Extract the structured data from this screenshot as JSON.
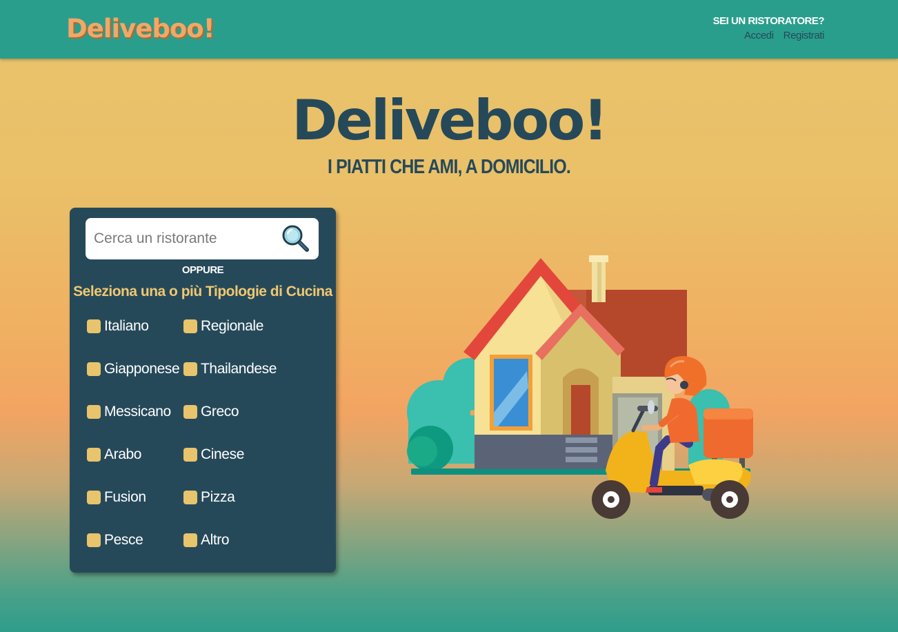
{
  "navbar": {
    "logo": "Deliveboo!",
    "restaurateur_question": "SEI UN RISTORATORE?",
    "login_label": "Accedi",
    "register_label": "Registrati"
  },
  "hero": {
    "title": "Deliveboo!",
    "subtitle": "I PIATTI CHE AMI, A DOMICILIO."
  },
  "search": {
    "placeholder": "Cerca un ristorante",
    "value": ""
  },
  "filters": {
    "separator": "OPPURE",
    "title": "Seleziona una o più Tipologie di Cucina",
    "cuisines": [
      {
        "label": "Italiano",
        "checked": false
      },
      {
        "label": "Regionale",
        "checked": false
      },
      {
        "label": "Giapponese",
        "checked": false
      },
      {
        "label": "Thailandese",
        "checked": false
      },
      {
        "label": "Messicano",
        "checked": false
      },
      {
        "label": "Greco",
        "checked": false
      },
      {
        "label": "Arabo",
        "checked": false
      },
      {
        "label": "Cinese",
        "checked": false
      },
      {
        "label": "Fusion",
        "checked": false
      },
      {
        "label": "Pizza",
        "checked": false
      },
      {
        "label": "Pesce",
        "checked": false
      },
      {
        "label": "Altro",
        "checked": false
      }
    ]
  },
  "colors": {
    "navbar_bg": "#2a9e8c",
    "brand_orange": "#f0a868",
    "dark_blue": "#26495a",
    "accent_yellow": "#e8c46c"
  },
  "icons": {
    "search": "magnifier-icon",
    "illustration": "delivery-scooter-house-illustration"
  }
}
